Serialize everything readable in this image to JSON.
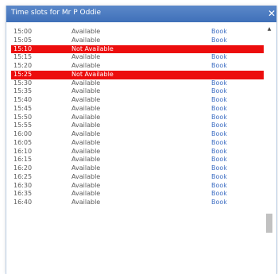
{
  "window": {
    "title": "Time slots for Mr P Oddie",
    "close_glyph": "✕"
  },
  "scrollbar": {
    "up_glyph": "▲"
  },
  "slots": [
    {
      "time": "15:00",
      "status": "Available",
      "action": "Book"
    },
    {
      "time": "15:05",
      "status": "Available",
      "action": "Book"
    },
    {
      "time": "15:10",
      "status": "Not Available",
      "action": ""
    },
    {
      "time": "15:15",
      "status": "Available",
      "action": "Book"
    },
    {
      "time": "15:20",
      "status": "Available",
      "action": "Book"
    },
    {
      "time": "15:25",
      "status": "Not Available",
      "action": ""
    },
    {
      "time": "15:30",
      "status": "Available",
      "action": "Book"
    },
    {
      "time": "15:35",
      "status": "Available",
      "action": "Book"
    },
    {
      "time": "15:40",
      "status": "Available",
      "action": "Book"
    },
    {
      "time": "15:45",
      "status": "Available",
      "action": "Book"
    },
    {
      "time": "15:50",
      "status": "Available",
      "action": "Book"
    },
    {
      "time": "15:55",
      "status": "Available",
      "action": "Book"
    },
    {
      "time": "16:00",
      "status": "Available",
      "action": "Book"
    },
    {
      "time": "16:05",
      "status": "Available",
      "action": "Book"
    },
    {
      "time": "16:10",
      "status": "Available",
      "action": "Book"
    },
    {
      "time": "16:15",
      "status": "Available",
      "action": "Book"
    },
    {
      "time": "16:20",
      "status": "Available",
      "action": "Book"
    },
    {
      "time": "16:25",
      "status": "Available",
      "action": "Book"
    },
    {
      "time": "16:30",
      "status": "Available",
      "action": "Book"
    },
    {
      "time": "16:35",
      "status": "Available",
      "action": "Book"
    },
    {
      "time": "16:40",
      "status": "Available",
      "action": "Book"
    }
  ]
}
